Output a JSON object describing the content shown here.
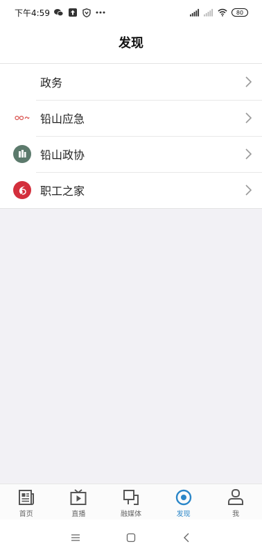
{
  "status_bar": {
    "time": "下午4:59",
    "battery": "80",
    "icons": [
      "wechat-icon",
      "upload-icon",
      "shield-icon",
      "more-icon",
      "signal-icon",
      "signal-icon-2",
      "wifi-icon"
    ]
  },
  "header": {
    "title": "发现"
  },
  "list": {
    "items": [
      {
        "label": "政务",
        "icon": "none"
      },
      {
        "label": "铅山应急",
        "icon": "emergency-logo-icon"
      },
      {
        "label": "铅山政协",
        "icon": "cppcc-logo-icon"
      },
      {
        "label": "职工之家",
        "icon": "workers-home-logo-icon"
      }
    ]
  },
  "bottom_nav": {
    "items": [
      {
        "label": "首页",
        "icon": "newspaper-icon"
      },
      {
        "label": "直播",
        "icon": "tv-play-icon"
      },
      {
        "label": "融媒体",
        "icon": "media-icon"
      },
      {
        "label": "发现",
        "icon": "discover-icon",
        "active": true
      },
      {
        "label": "我",
        "icon": "person-icon"
      }
    ]
  },
  "colors": {
    "accent": "#2a86c8",
    "background": "#f2f1f5"
  }
}
